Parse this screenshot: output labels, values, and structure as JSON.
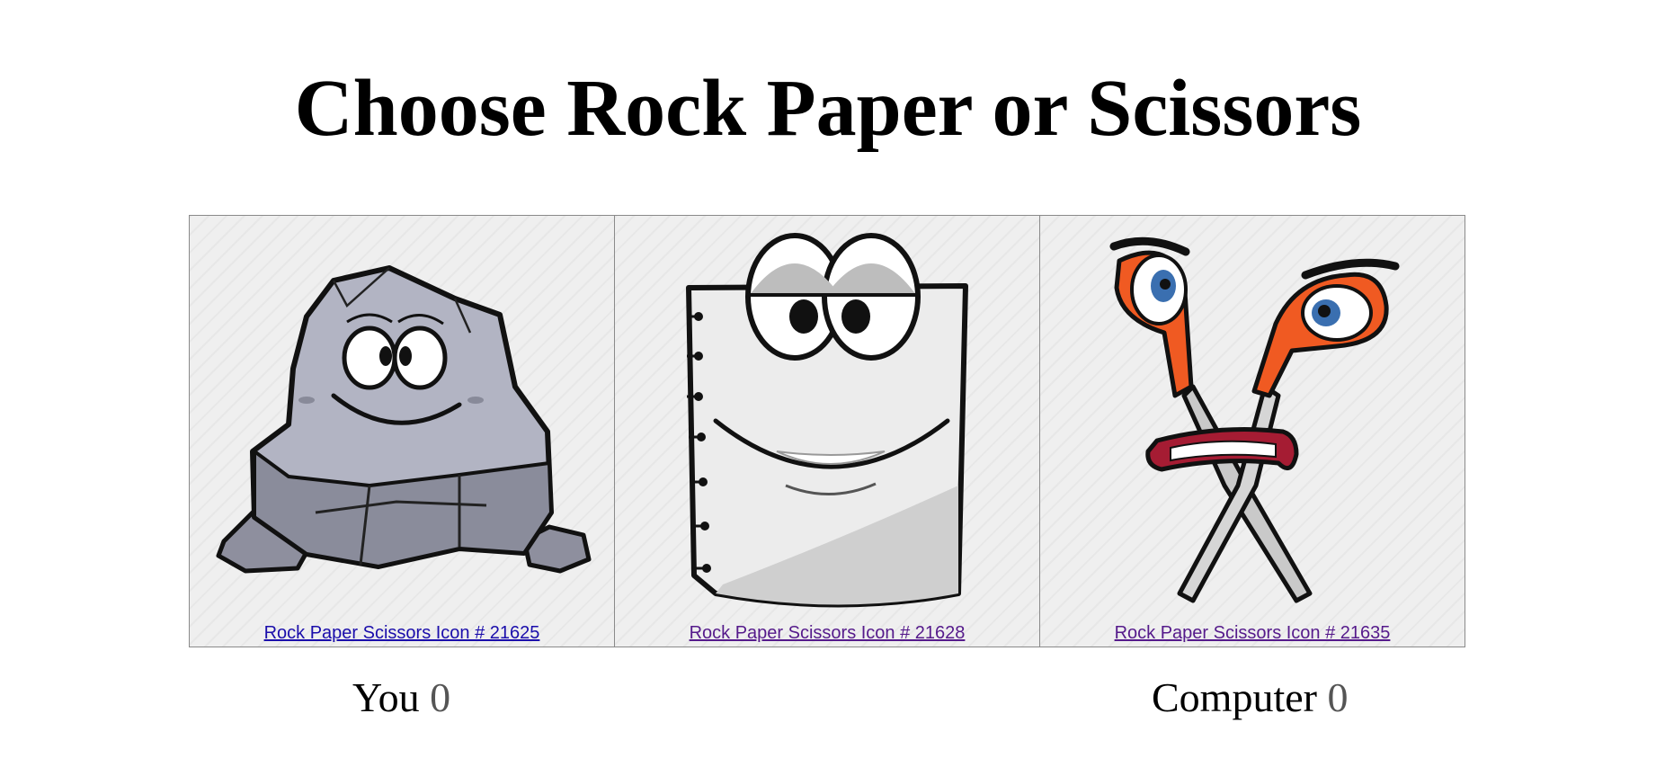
{
  "title": "Choose Rock Paper or Scissors",
  "choices": [
    {
      "name": "rock",
      "icon": "rock-character-icon",
      "link_text": "Rock Paper Scissors Icon # 21625"
    },
    {
      "name": "paper",
      "icon": "paper-character-icon",
      "link_text": "Rock Paper Scissors Icon # 21628"
    },
    {
      "name": "scissors",
      "icon": "scissors-character-icon",
      "link_text": "Rock Paper Scissors Icon # 21635"
    }
  ],
  "scores": {
    "you_label": "You",
    "you_value": "0",
    "computer_label": "Computer",
    "computer_value": "0"
  },
  "colors": {
    "link_unvisited": "#1a0dab",
    "link_visited": "#551a8b",
    "card_background": "#efefef",
    "scissors_handle": "#f05a22"
  }
}
